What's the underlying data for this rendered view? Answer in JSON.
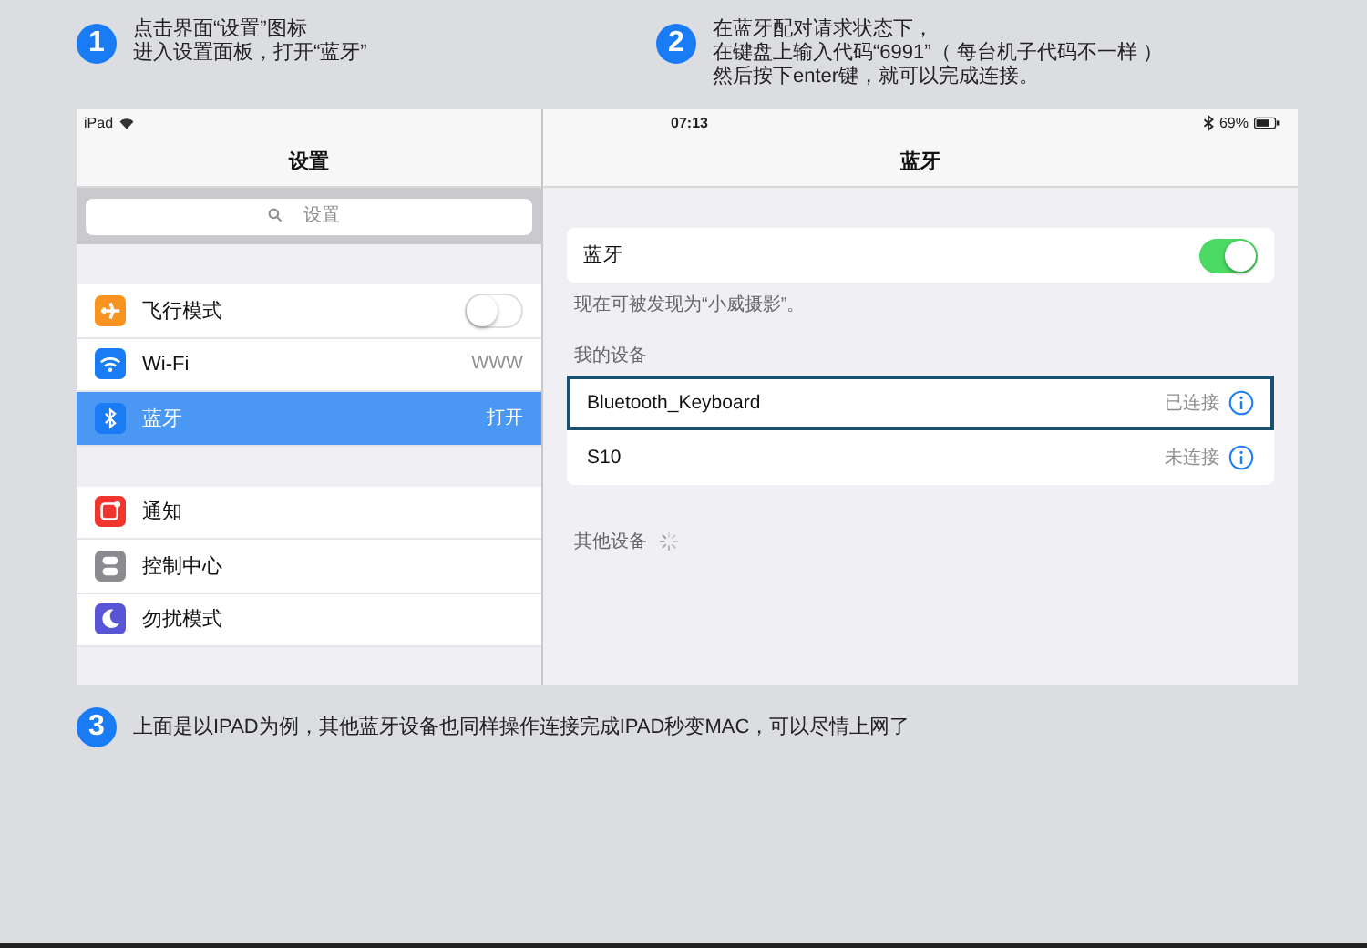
{
  "steps": [
    {
      "number": "1",
      "lines": [
        "点击界面“设置”图标",
        "进入设置面板，打开“蓝牙”"
      ]
    },
    {
      "number": "2",
      "lines": [
        "在蓝牙配对请求状态下，",
        "在键盘上输入代码“6991”（ 每台机子代码不一样 ）",
        "然后按下enter键，就可以完成连接。"
      ]
    }
  ],
  "ipad": {
    "status_bar": {
      "device": "iPad",
      "time": "07:13",
      "battery": "69%"
    },
    "sidebar": {
      "title": "设置",
      "search": {
        "placeholder": "设置"
      },
      "groups": [
        [
          {
            "kind": "airplane",
            "label": "飞行模式",
            "on": false,
            "selected": false
          },
          {
            "kind": "wifi",
            "label": "Wi-Fi",
            "value": "WWW",
            "selected": false
          },
          {
            "kind": "bluetooth",
            "label": "蓝牙",
            "value": "打开",
            "selected": true
          }
        ],
        [
          {
            "kind": "notifications",
            "label": "通知",
            "selected": false
          },
          {
            "kind": "control",
            "label": "控制中心",
            "selected": false
          },
          {
            "kind": "moon",
            "label": "勿扰模式",
            "selected": false
          }
        ]
      ]
    },
    "detail": {
      "title": "蓝牙",
      "bluetooth_toggle": {
        "label": "蓝牙",
        "on": true
      },
      "caption": "现在可被发现为“小威摄影”。",
      "my_devices_header": "我的设备",
      "devices": [
        {
          "name": "Bluetooth_Keyboard",
          "status": "已连接",
          "selected": true
        },
        {
          "name": "S10",
          "status": "未连接",
          "selected": false
        }
      ],
      "other_devices_header": "其他设备"
    }
  },
  "note": {
    "number": "3",
    "text": "上面是以IPAD为例，其他蓝牙设备也同样操作连接完成IPAD秒变MAC，可以尽情上网了"
  }
}
